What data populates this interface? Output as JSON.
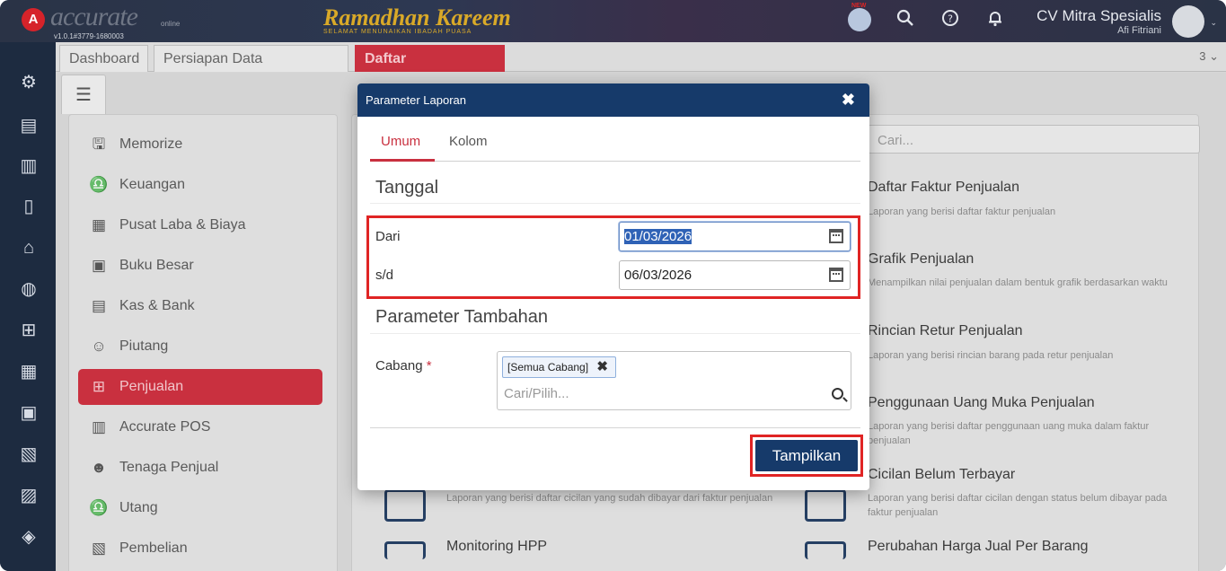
{
  "app": {
    "logo_letter": "A",
    "logo_text": "accurate",
    "logo_sub": "online",
    "version": "v1.0.1#3779-1680003",
    "banner_title": "Ramadhan Kareem",
    "banner_sub": "SELAMAT MENUNAIKAN IBADAH PUASA",
    "company": "CV Mitra Spesialis",
    "user": "Afi Fitriani",
    "new_badge": "NEW"
  },
  "tabs": {
    "items": [
      {
        "label": "Dashboard"
      },
      {
        "label": "Persiapan Data Perusahaan"
      },
      {
        "label": "Daftar Laporan"
      }
    ],
    "close_glyph": "✖",
    "count": "3 ⌄"
  },
  "menu": {
    "items": [
      {
        "label": "Memorize",
        "icon": "save-icon"
      },
      {
        "label": "Keuangan",
        "icon": "finance-icon"
      },
      {
        "label": "Pusat Laba & Biaya",
        "icon": "cost-center-icon"
      },
      {
        "label": "Buku Besar",
        "icon": "ledger-icon"
      },
      {
        "label": "Kas & Bank",
        "icon": "cash-bank-icon"
      },
      {
        "label": "Piutang",
        "icon": "receivable-icon"
      },
      {
        "label": "Penjualan",
        "icon": "cart-icon"
      },
      {
        "label": "Accurate POS",
        "icon": "pos-icon"
      },
      {
        "label": "Tenaga Penjual",
        "icon": "salesperson-icon"
      },
      {
        "label": "Utang",
        "icon": "payable-icon"
      },
      {
        "label": "Pembelian",
        "icon": "purchase-icon"
      }
    ]
  },
  "reports": {
    "search_placeholder": "Cari...",
    "items": [
      {
        "title": "Daftar Faktur Penjualan",
        "desc": "Laporan yang berisi daftar faktur penjualan"
      },
      {
        "title": "Grafik Penjualan",
        "desc": "Menampilkan nilai penjualan dalam bentuk grafik berdasarkan waktu"
      },
      {
        "title": "Rincian Retur Penjualan",
        "desc": "Laporan yang berisi rincian barang pada retur penjualan"
      },
      {
        "title": "Penggunaan Uang Muka Penjualan",
        "desc": "Laporan yang berisi daftar penggunaan uang muka dalam faktur penjualan"
      },
      {
        "title": "Cicilan Belum Terbayar",
        "desc": "Laporan yang berisi daftar cicilan dengan status belum dibayar pada faktur penjualan"
      },
      {
        "title": "Perubahan Harga Jual Per Barang",
        "desc": ""
      }
    ],
    "left_desc": "Laporan yang berisi daftar cicilan yang sudah dibayar dari faktur penjualan",
    "left_title": "Monitoring HPP"
  },
  "modal": {
    "title": "Parameter Laporan",
    "close": "✖",
    "tabs": [
      "Umum",
      "Kolom"
    ],
    "section_date": "Tanggal",
    "from_label": "Dari",
    "from_value": "01/03/2026",
    "to_label": "s/d",
    "to_value": "06/03/2026",
    "section_extra": "Parameter Tambahan",
    "branch_label": "Cabang",
    "required_mark": "*",
    "branch_chip": "[Semua Cabang]",
    "branch_chip_x": "✖",
    "branch_placeholder": "Cari/Pilih...",
    "submit": "Tampilkan"
  },
  "colors": {
    "accent_red": "#c9303f",
    "navy": "#163a6a",
    "highlight_red": "#e02424"
  }
}
